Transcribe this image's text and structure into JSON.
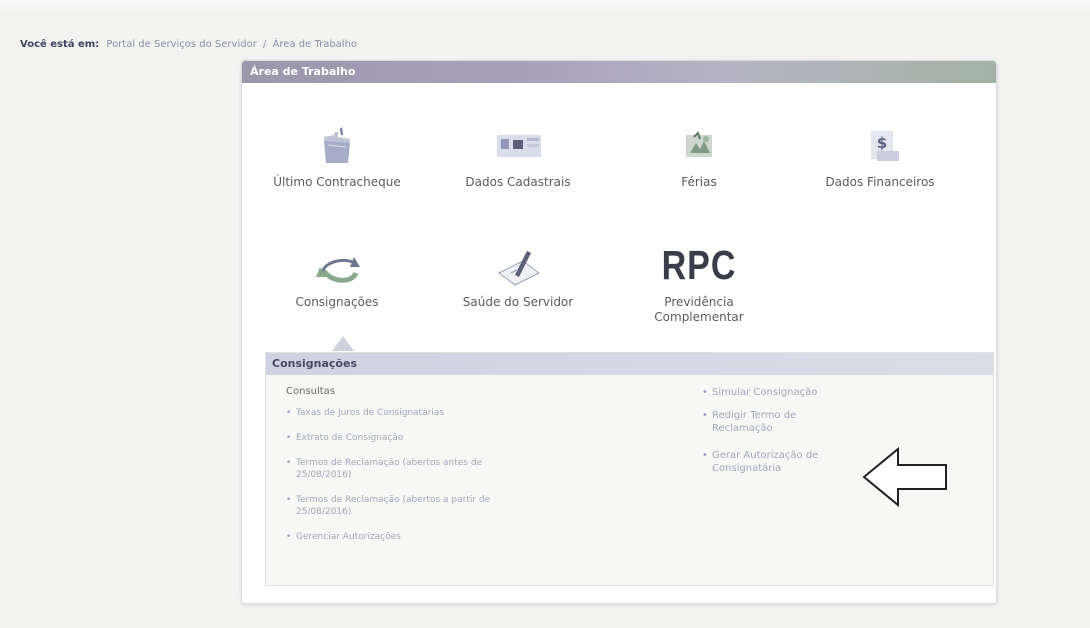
{
  "breadcrumb": {
    "prefix": "Você está em:",
    "items": [
      "Portal de Serviços do Servidor",
      "Área de Trabalho"
    ],
    "separator": "/"
  },
  "panel": {
    "title": "Área de Trabalho",
    "tiles": [
      {
        "label": "Último Contracheque",
        "icon": "folder-icon"
      },
      {
        "label": "Dados Cadastrais",
        "icon": "id-card-icon"
      },
      {
        "label": "Férias",
        "icon": "vacation-icon"
      },
      {
        "label": "Dados Financeiros",
        "icon": "money-document-icon"
      },
      {
        "label": "Consignações",
        "icon": "refresh-arrow-icon"
      },
      {
        "label": "Saúde do Servidor",
        "icon": "health-document-icon"
      },
      {
        "label": "Previdência Complementar",
        "icon": "rpc-logo",
        "logo_text": "RPC"
      }
    ]
  },
  "consignacoes": {
    "title": "Consignações",
    "consultas_title": "Consultas",
    "left_links": [
      "Taxas de Juros de Consignatárias",
      "Extrato de Consignação",
      "Termos de Reclamação (abertos antes de 25/08/2016)",
      "Termos de Reclamação (abertos a partir de 25/08/2016)",
      "Gerenciar Autorizações"
    ],
    "right_links": [
      "Simular Consignação",
      "Redigir Termo de Reclamação",
      "Gerar Autorização de Consignatária"
    ]
  },
  "colors": {
    "header_bar": "#a9a2bd",
    "sub_header": "#d2d5e3",
    "link": "#a2a6bc"
  }
}
